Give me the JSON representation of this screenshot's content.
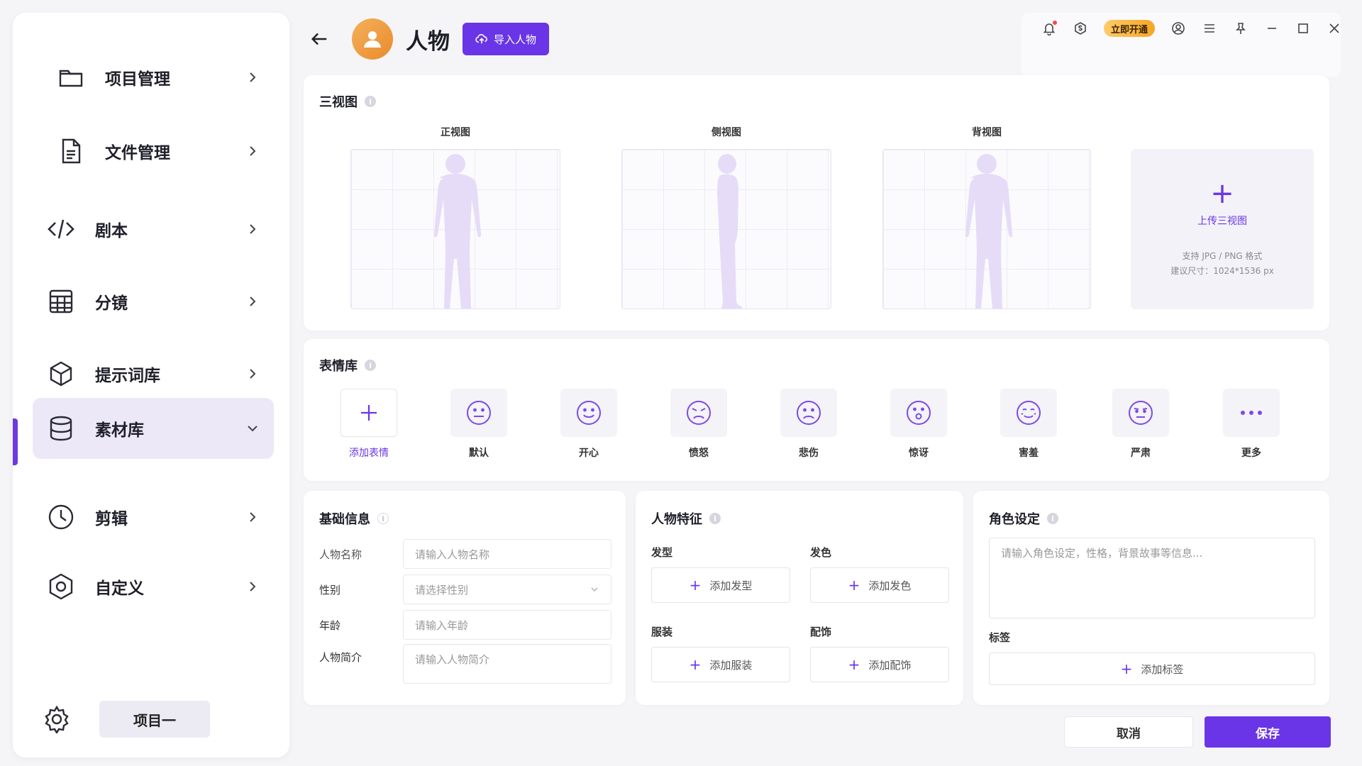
{
  "sidebar": {
    "items": [
      {
        "label": "项目管理",
        "icon": "folder-icon"
      },
      {
        "label": "文件管理",
        "icon": "file-icon"
      },
      {
        "label": "剧本",
        "icon": "code-icon"
      },
      {
        "label": "分镜",
        "icon": "storyboard-icon"
      },
      {
        "label": "提示词库",
        "icon": "cube-icon"
      },
      {
        "label": "素材库",
        "icon": "database-icon",
        "active": true
      },
      {
        "label": "剪辑",
        "icon": "clock-icon"
      },
      {
        "label": "自定义",
        "icon": "hexagon-icon"
      }
    ],
    "project_name": "项目一"
  },
  "header": {
    "title": "人物",
    "import_label": "导入人物",
    "vip_label": "立即开通"
  },
  "three_view": {
    "title": "三视图",
    "views": [
      "正视图",
      "侧视图",
      "背视图"
    ],
    "upload_label": "上传三视图",
    "upload_hint_format": "支持 JPG / PNG 格式",
    "upload_hint_size": "建议尺寸：1024*1536 px"
  },
  "expressions": {
    "title": "表情库",
    "items": [
      "添加表情",
      "默认",
      "开心",
      "愤怒",
      "悲伤",
      "惊讶",
      "害羞",
      "严肃",
      "更多"
    ]
  },
  "basic_info": {
    "title": "基础信息",
    "name_label": "人物名称",
    "name_placeholder": "请输入人物名称",
    "gender_label": "性别",
    "gender_placeholder": "请选择性别",
    "age_label": "年龄",
    "age_placeholder": "请输入年龄",
    "intro_label": "人物简介",
    "intro_placeholder": "请输入人物简介"
  },
  "features": {
    "title": "人物特征",
    "hairstyle_label": "发型",
    "hairstyle_add": "添加发型",
    "haircolor_label": "发色",
    "haircolor_add": "添加发色",
    "clothing_label": "服装",
    "clothing_add": "添加服装",
    "accessory_label": "配饰",
    "accessory_add": "添加配饰"
  },
  "role": {
    "title": "角色设定",
    "placeholder": "请输入角色设定，性格，背景故事等信息...",
    "tags_label": "标签",
    "tags_add": "添加标签"
  },
  "footer": {
    "cancel_label": "取消",
    "save_label": "保存"
  },
  "colors": {
    "accent": "#6a35e6",
    "active_bg": "#ece8f8",
    "silhouette": "#e6dcf8"
  }
}
